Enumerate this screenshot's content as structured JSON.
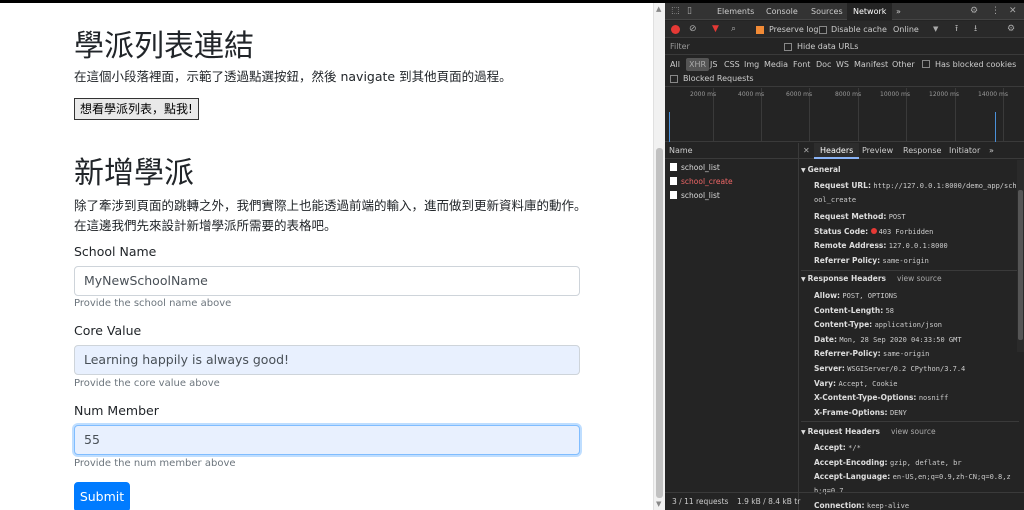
{
  "page": {
    "heading1": "學派列表連結",
    "para1": "在這個小段落裡面，示範了透過點選按鈕，然後 navigate 到其他頁面的過程。",
    "list_button": "想看學派列表，點我!",
    "heading2": "新增學派",
    "para2": "除了牽涉到頁面的跳轉之外，我們實際上也能透過前端的輸入，進而做到更新資料庫的動作。在這邊我們先來設計新增學派所需要的表格吧。",
    "fields": [
      {
        "label": "School Name",
        "value": "MyNewSchoolName",
        "help": "Provide the school name above"
      },
      {
        "label": "Core Value",
        "value": "Learning happily is always good!",
        "help": "Provide the core value above"
      },
      {
        "label": "Num Member",
        "value": "55",
        "help": "Provide the num member above"
      }
    ],
    "submit": "Submit"
  },
  "devtools": {
    "tabs": [
      "Elements",
      "Console",
      "Sources",
      "Network"
    ],
    "active_tab": "Network",
    "more": "»",
    "preserve_log": "Preserve log",
    "disable_cache": "Disable cache",
    "throttle": "Online",
    "filter_placeholder": "Filter",
    "hide_data_urls": "Hide data URLs",
    "types": [
      "All",
      "XHR",
      "JS",
      "CSS",
      "Img",
      "Media",
      "Font",
      "Doc",
      "WS",
      "Manifest",
      "Other"
    ],
    "has_blocked_cookies": "Has blocked cookies",
    "blocked_requests": "Blocked Requests",
    "ticks": [
      "2000 ms",
      "4000 ms",
      "6000 ms",
      "8000 ms",
      "10000 ms",
      "12000 ms",
      "14000 ms"
    ],
    "name_header": "Name",
    "requests": [
      "school_list",
      "school_create",
      "school_list"
    ],
    "footer_requests": "3 / 11 requests",
    "footer_size": "1.9 kB / 8.4 kB tr",
    "detail_tabs": [
      "Headers",
      "Preview",
      "Response",
      "Initiator"
    ],
    "general": {
      "title": "General",
      "request_url_k": "Request URL:",
      "request_url_v": "http://127.0.0.1:8000/demo_app/school_create",
      "method_k": "Request Method:",
      "method_v": "POST",
      "status_k": "Status Code:",
      "status_v": "403 Forbidden",
      "remote_k": "Remote Address:",
      "remote_v": "127.0.0.1:8000",
      "referrer_k": "Referrer Policy:",
      "referrer_v": "same-origin"
    },
    "response_headers": {
      "title": "Response Headers",
      "view_source": "view source",
      "items": [
        {
          "k": "Allow:",
          "v": "POST, OPTIONS"
        },
        {
          "k": "Content-Length:",
          "v": "58"
        },
        {
          "k": "Content-Type:",
          "v": "application/json"
        },
        {
          "k": "Date:",
          "v": "Mon, 28 Sep 2020 04:33:50 GMT"
        },
        {
          "k": "Referrer-Policy:",
          "v": "same-origin"
        },
        {
          "k": "Server:",
          "v": "WSGIServer/0.2 CPython/3.7.4"
        },
        {
          "k": "Vary:",
          "v": "Accept, Cookie"
        },
        {
          "k": "X-Content-Type-Options:",
          "v": "nosniff"
        },
        {
          "k": "X-Frame-Options:",
          "v": "DENY"
        }
      ]
    },
    "request_headers": {
      "title": "Request Headers",
      "view_source": "view source",
      "items": [
        {
          "k": "Accept:",
          "v": "*/*"
        },
        {
          "k": "Accept-Encoding:",
          "v": "gzip, deflate, br"
        },
        {
          "k": "Accept-Language:",
          "v": "en-US,en;q=0.9,zh-CN;q=0.8,zh;q=0.7"
        },
        {
          "k": "Connection:",
          "v": "keep-alive"
        }
      ]
    }
  }
}
